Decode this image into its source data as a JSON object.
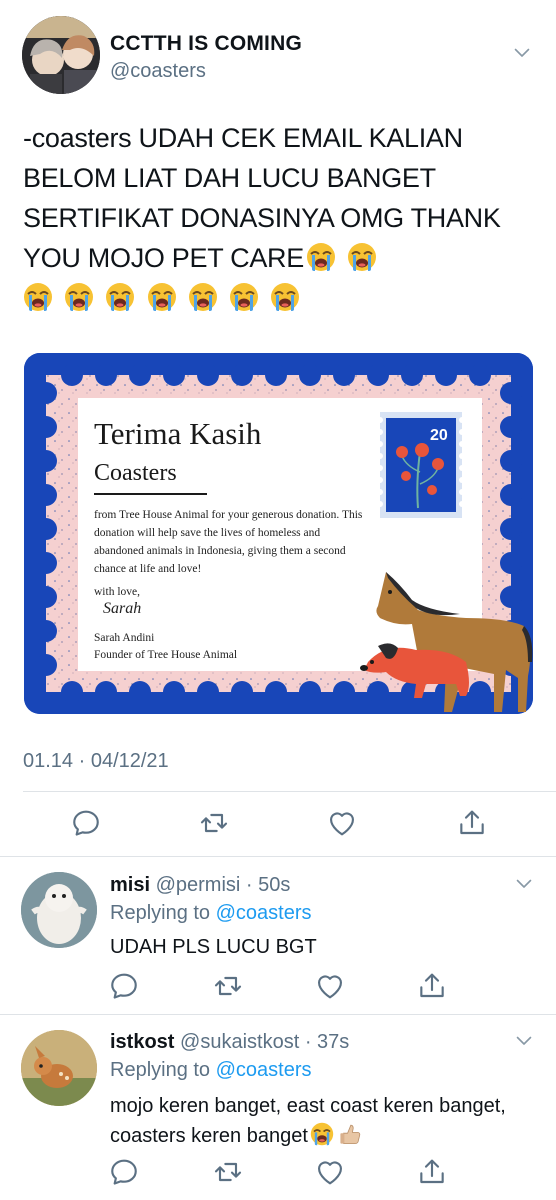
{
  "tweet": {
    "author_name": "CCTTH IS COMING",
    "author_handle": "@coasters",
    "text": "-coasters UDAH CEK EMAIL KALIAN BELOM LIAT DAH LUCU BANGET SERTIFIKAT DONASINYA OMG THANK YOU MOJO PET CARE",
    "emoji_after_text": "loudly-crying-face x9",
    "timestamp": "01.14 · 04/12/21",
    "actions": [
      "reply",
      "retweet",
      "like",
      "share"
    ]
  },
  "certificate": {
    "title": "Terima Kasih",
    "recipient": "Coasters",
    "body": "from Tree House Animal  for your generous donation. This donation will help save the lives of homeless and abandoned animals in Indonesia, giving them a second chance at life and love!",
    "closing": "with love,",
    "signature": "Sarah",
    "signer": "Sarah Andini",
    "signer_title": "Founder of Tree House Animal",
    "stamp_value": "20"
  },
  "replies": [
    {
      "name": "misi",
      "handle": "@permisi",
      "age": "· 50s",
      "replying_prefix": "Replying to",
      "replying_to": "@coasters",
      "text": "UDAH PLS LUCU BGT"
    },
    {
      "name": "istkost",
      "handle": "@sukaistkost",
      "age": "· 37s",
      "replying_prefix": "Replying to",
      "replying_to": "@coasters",
      "text": "mojo keren banget, east coast keren banget, coasters keren banget",
      "emoji_after_text": "loudly-crying-face, thumbs-up"
    }
  ],
  "colors": {
    "accent": "#1d9bf0",
    "muted": "#5b7083",
    "certificate_blue": "#1846b8",
    "certificate_pink": "#f5d0d0"
  }
}
